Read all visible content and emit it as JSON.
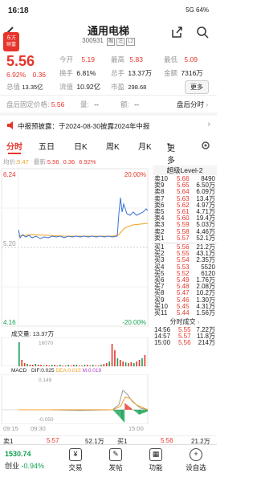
{
  "status_bar": {
    "time": "16:18",
    "right": "5G 64%"
  },
  "header": {
    "title": "通用电梯",
    "code": "300931",
    "tag1": "融",
    "tag2": "注",
    "tag3": "L2"
  },
  "float_badge": {
    "line1": "东方",
    "line2": "财富"
  },
  "quote": {
    "price": "5.56",
    "change_pct": "6.92%",
    "change": "0.36",
    "open_label": "今开",
    "open": "5.19",
    "high_label": "最高",
    "high": "5.83",
    "low_label": "最低",
    "low": "5.09",
    "turnover_label": "换手",
    "turnover": "6.81%",
    "hands_label": "总手",
    "hands": "13.37万",
    "amount_label": "金额",
    "amount": "7316万",
    "mcap_label": "总值",
    "mcap": "13.35亿",
    "float_label": "流值",
    "float": "10.92亿",
    "pe_label": "市盈",
    "pe": "298.68",
    "more": "更多"
  },
  "after_hours": {
    "fixed_label": "盘后固定价格:",
    "fixed": "5.56",
    "vol_label": "量:",
    "vol": "--",
    "amt_label": "额:",
    "amt": "--",
    "timeshare": "盘后分时"
  },
  "notice": {
    "text": "中报预披露：于2024-08-30披露2024年中报"
  },
  "tabs": [
    "分时",
    "五日",
    "日K",
    "周K",
    "月K",
    "更多"
  ],
  "chart_header": {
    "avg_label": "均价:",
    "avg": "5.47",
    "latest_label": "最新:",
    "latest": "5.56",
    "chg": "0.36",
    "pct": "6.92%"
  },
  "chart_data": {
    "type": "line",
    "title": "",
    "y_left_top": "6.24",
    "y_left_mid": "5.20",
    "y_left_bottom": "4.16",
    "y_right_top": "20.00%",
    "y_right_bottom": "-20.00%",
    "x_labels": [
      "09:15",
      "09:30",
      "15:00"
    ],
    "price_series_note": "intraday",
    "volume_label": "成交量",
    "volume_value": "13.37万",
    "volume_max": "16070",
    "macd_label": "MACD",
    "dif_label": "DIF:",
    "dif": "0.025",
    "dea_label": "DEA:",
    "dea": "0.015",
    "m_label": "M:",
    "m": "0.019",
    "macd_top": "0.149",
    "macd_bottom": "-0.050"
  },
  "level2": {
    "title": "超级Level-2"
  },
  "asks": [
    {
      "label": "卖10",
      "price": "5.66",
      "vol": "8490"
    },
    {
      "label": "卖9",
      "price": "5.65",
      "vol": "6.50万"
    },
    {
      "label": "卖8",
      "price": "5.64",
      "vol": "6.09万"
    },
    {
      "label": "卖7",
      "price": "5.63",
      "vol": "13.4万"
    },
    {
      "label": "卖6",
      "price": "5.62",
      "vol": "4.97万"
    },
    {
      "label": "卖5",
      "price": "5.61",
      "vol": "4.71万"
    },
    {
      "label": "卖4",
      "price": "5.60",
      "vol": "19.4万"
    },
    {
      "label": "卖3",
      "price": "5.59",
      "vol": "5.03万"
    },
    {
      "label": "卖2",
      "price": "5.58",
      "vol": "4.46万"
    },
    {
      "label": "卖1",
      "price": "5.57",
      "vol": "52.1万"
    }
  ],
  "bids": [
    {
      "label": "买1",
      "price": "5.56",
      "vol": "21.2万"
    },
    {
      "label": "买2",
      "price": "5.55",
      "vol": "43.1万"
    },
    {
      "label": "买3",
      "price": "5.54",
      "vol": "2.35万"
    },
    {
      "label": "买4",
      "price": "5.53",
      "vol": "5520"
    },
    {
      "label": "买5",
      "price": "5.52",
      "vol": "6120"
    },
    {
      "label": "买6",
      "price": "5.49",
      "vol": "1.76万"
    },
    {
      "label": "买7",
      "price": "5.48",
      "vol": "2.08万"
    },
    {
      "label": "买8",
      "price": "5.47",
      "vol": "10.2万"
    },
    {
      "label": "买9",
      "price": "5.46",
      "vol": "1.30万"
    },
    {
      "label": "买10",
      "price": "5.45",
      "vol": "4.31万"
    },
    {
      "label": "买11",
      "price": "5.44",
      "vol": "1.56万"
    }
  ],
  "trades": {
    "title": "分时成交",
    "rows": [
      {
        "time": "14:56",
        "price": "5.55",
        "vol": "7.22万"
      },
      {
        "time": "14:57",
        "price": "5.57",
        "vol": "11.8万"
      },
      {
        "time": "15:00",
        "price": "5.56",
        "vol": "214万"
      }
    ]
  },
  "bottom_quote": {
    "ask_label": "卖1",
    "ask_price": "5.57",
    "ask_vol": "52.1万",
    "bid_label": "买1",
    "bid_price": "5.56",
    "bid_vol": "21.2万"
  },
  "bottom_nav": {
    "index_value": "1530.74",
    "index_name": "创业",
    "index_pct": "-0.94%",
    "items": [
      "交易",
      "发帖",
      "功能",
      "设自选"
    ]
  },
  "colors": {
    "up": "#e5352b",
    "down": "#12a050",
    "avg": "#f0a020",
    "price_line": "#3a73d8"
  }
}
